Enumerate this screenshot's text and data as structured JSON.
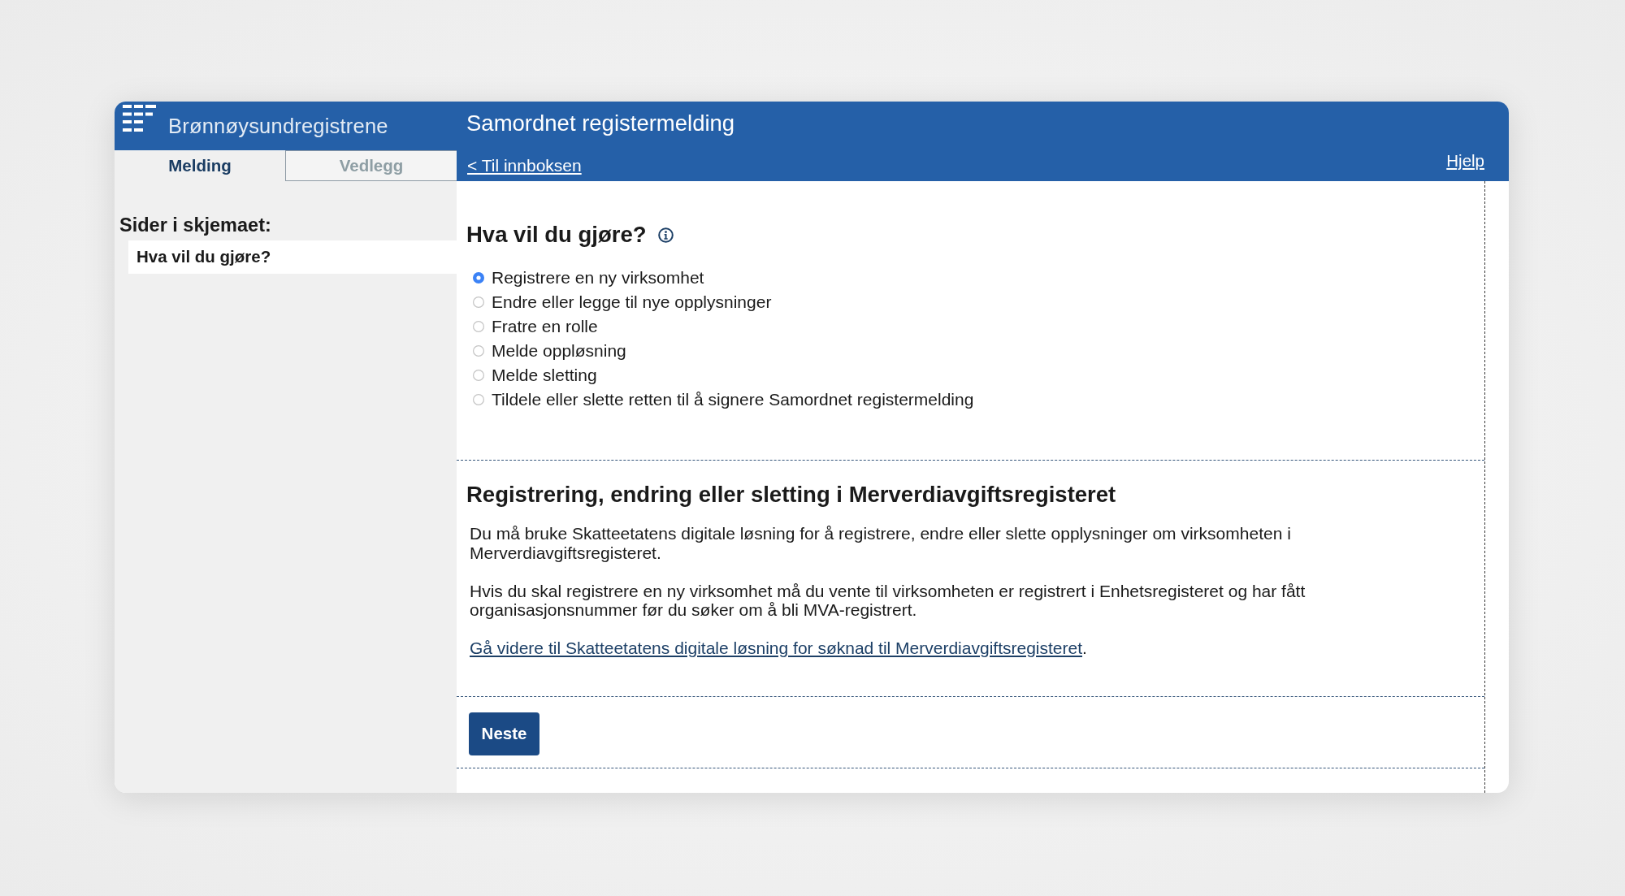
{
  "header": {
    "brand": "Brønnøysundregistrene",
    "title": "Samordnet registermelding",
    "tabs": [
      {
        "label": "Melding",
        "selected": true
      },
      {
        "label": "Vedlegg",
        "selected": false
      }
    ],
    "back_link": "< Til innboksen",
    "help_link": "Hjelp"
  },
  "sidebar": {
    "heading": "Sider i skjemaet:",
    "items": [
      {
        "label": "Hva vil du gjøre?",
        "selected": true
      }
    ]
  },
  "question": {
    "heading": "Hva vil du gjøre?",
    "options": [
      {
        "label": "Registrere en ny virksomhet",
        "selected": true
      },
      {
        "label": "Endre eller legge til nye opplysninger",
        "selected": false
      },
      {
        "label": "Fratre en rolle",
        "selected": false
      },
      {
        "label": "Melde oppløsning",
        "selected": false
      },
      {
        "label": "Melde sletting",
        "selected": false
      },
      {
        "label": "Tildele eller slette retten til å signere Samordnet registermelding",
        "selected": false
      }
    ]
  },
  "notice": {
    "heading": "Registrering, endring eller sletting i Merverdiavgiftsregisteret",
    "paragraphs": [
      "Du må bruke Skatteetatens digitale løsning for å registrere, endre eller slette opplysninger om virksomheten i Merverdiavgiftsregisteret.",
      "Hvis du skal registrere en ny virksomhet må du vente til virksomheten er registrert i Enhetsregisteret og har fått organisasjonsnummer før du søker om å bli MVA-registrert."
    ],
    "link": {
      "text": "Gå videre til Skatteetatens digitale løsning for søknad til Merverdiavgiftsregisteret",
      "suffix": "."
    }
  },
  "next_button": "Neste"
}
